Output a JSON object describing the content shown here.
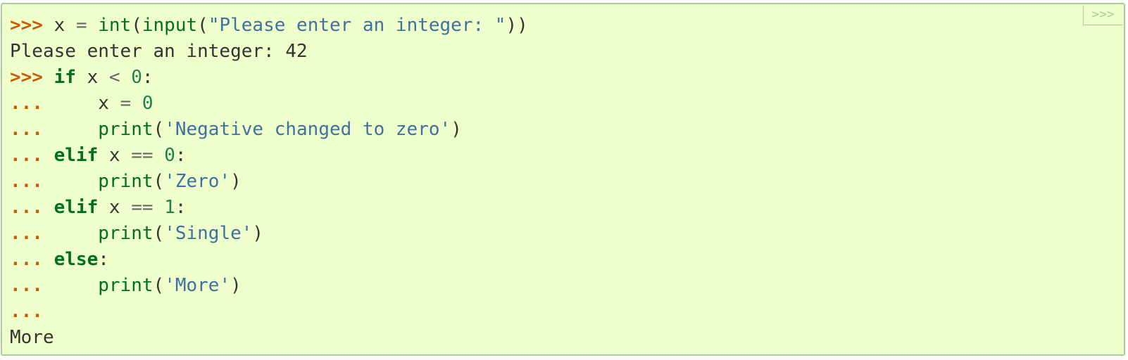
{
  "copy_button": {
    "label": ">>>"
  },
  "lines": [
    {
      "name": "code-line-1",
      "tokens": [
        {
          "t": "gp",
          "v": ">>>"
        },
        {
          "t": "",
          "v": " x "
        },
        {
          "t": "o",
          "v": "="
        },
        {
          "t": "",
          "v": " "
        },
        {
          "t": "nb",
          "v": "int"
        },
        {
          "t": "",
          "v": "("
        },
        {
          "t": "nb",
          "v": "input"
        },
        {
          "t": "",
          "v": "("
        },
        {
          "t": "s",
          "v": "\"Please enter an integer: \""
        },
        {
          "t": "",
          "v": "))"
        }
      ]
    },
    {
      "name": "output-line-1",
      "tokens": [
        {
          "t": "go",
          "v": "Please enter an integer: 42"
        }
      ]
    },
    {
      "name": "code-line-2",
      "tokens": [
        {
          "t": "gp",
          "v": ">>>"
        },
        {
          "t": "",
          "v": " "
        },
        {
          "t": "k",
          "v": "if"
        },
        {
          "t": "",
          "v": " x "
        },
        {
          "t": "o",
          "v": "<"
        },
        {
          "t": "",
          "v": " "
        },
        {
          "t": "mi",
          "v": "0"
        },
        {
          "t": "",
          "v": ":"
        }
      ]
    },
    {
      "name": "code-line-3",
      "tokens": [
        {
          "t": "gp",
          "v": "..."
        },
        {
          "t": "",
          "v": "     x "
        },
        {
          "t": "o",
          "v": "="
        },
        {
          "t": "",
          "v": " "
        },
        {
          "t": "mi",
          "v": "0"
        }
      ]
    },
    {
      "name": "code-line-4",
      "tokens": [
        {
          "t": "gp",
          "v": "..."
        },
        {
          "t": "",
          "v": "     "
        },
        {
          "t": "nb",
          "v": "print"
        },
        {
          "t": "",
          "v": "("
        },
        {
          "t": "s",
          "v": "'Negative changed to zero'"
        },
        {
          "t": "",
          "v": ")"
        }
      ]
    },
    {
      "name": "code-line-5",
      "tokens": [
        {
          "t": "gp",
          "v": "..."
        },
        {
          "t": "",
          "v": " "
        },
        {
          "t": "k",
          "v": "elif"
        },
        {
          "t": "",
          "v": " x "
        },
        {
          "t": "o",
          "v": "=="
        },
        {
          "t": "",
          "v": " "
        },
        {
          "t": "mi",
          "v": "0"
        },
        {
          "t": "",
          "v": ":"
        }
      ]
    },
    {
      "name": "code-line-6",
      "tokens": [
        {
          "t": "gp",
          "v": "..."
        },
        {
          "t": "",
          "v": "     "
        },
        {
          "t": "nb",
          "v": "print"
        },
        {
          "t": "",
          "v": "("
        },
        {
          "t": "s",
          "v": "'Zero'"
        },
        {
          "t": "",
          "v": ")"
        }
      ]
    },
    {
      "name": "code-line-7",
      "tokens": [
        {
          "t": "gp",
          "v": "..."
        },
        {
          "t": "",
          "v": " "
        },
        {
          "t": "k",
          "v": "elif"
        },
        {
          "t": "",
          "v": " x "
        },
        {
          "t": "o",
          "v": "=="
        },
        {
          "t": "",
          "v": " "
        },
        {
          "t": "mi",
          "v": "1"
        },
        {
          "t": "",
          "v": ":"
        }
      ]
    },
    {
      "name": "code-line-8",
      "tokens": [
        {
          "t": "gp",
          "v": "..."
        },
        {
          "t": "",
          "v": "     "
        },
        {
          "t": "nb",
          "v": "print"
        },
        {
          "t": "",
          "v": "("
        },
        {
          "t": "s",
          "v": "'Single'"
        },
        {
          "t": "",
          "v": ")"
        }
      ]
    },
    {
      "name": "code-line-9",
      "tokens": [
        {
          "t": "gp",
          "v": "..."
        },
        {
          "t": "",
          "v": " "
        },
        {
          "t": "k",
          "v": "else"
        },
        {
          "t": "",
          "v": ":"
        }
      ]
    },
    {
      "name": "code-line-10",
      "tokens": [
        {
          "t": "gp",
          "v": "..."
        },
        {
          "t": "",
          "v": "     "
        },
        {
          "t": "nb",
          "v": "print"
        },
        {
          "t": "",
          "v": "("
        },
        {
          "t": "s",
          "v": "'More'"
        },
        {
          "t": "",
          "v": ")"
        }
      ]
    },
    {
      "name": "code-line-11",
      "tokens": [
        {
          "t": "gp",
          "v": "..."
        }
      ]
    },
    {
      "name": "output-line-2",
      "tokens": [
        {
          "t": "go",
          "v": "More"
        }
      ]
    }
  ]
}
